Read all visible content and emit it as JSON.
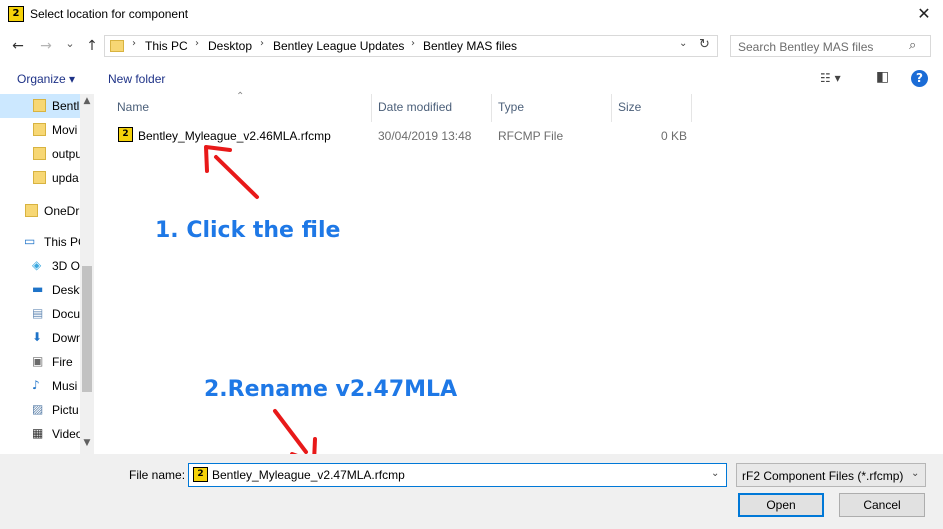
{
  "window": {
    "title": "Select location for component",
    "app_icon_label": "2",
    "close_glyph": "✕"
  },
  "address_bar": {
    "back_glyph": "←",
    "forward_glyph": "→",
    "recent_glyph": "⌄",
    "up_glyph": "↑",
    "breadcrumb": [
      "This PC",
      "Desktop",
      "Bentley League Updates",
      "Bentley MAS files"
    ],
    "crumb_separator": "›",
    "dropdown_glyph": "⌄",
    "refresh_glyph": "↻"
  },
  "search": {
    "placeholder": "Search Bentley MAS files",
    "icon_glyph": "⌕"
  },
  "toolbar": {
    "organize_label": "Organize ▾",
    "new_folder_label": "New folder",
    "view_glyph": "☷ ▾",
    "pane_glyph": "◧",
    "help_glyph": "?"
  },
  "nav_pane": {
    "items": [
      {
        "label": "Bentl",
        "icon": "folder-icon"
      },
      {
        "label": "Movi",
        "icon": "folder-icon"
      },
      {
        "label": "outpu",
        "icon": "folder-icon"
      },
      {
        "label": "upda",
        "icon": "folder-icon"
      },
      {
        "label": "OneDr",
        "icon": "folder-icon"
      },
      {
        "label": "This PC",
        "icon": "computer-icon"
      },
      {
        "label": "3D O",
        "icon": "cube-icon"
      },
      {
        "label": "Deskt",
        "icon": "desktop-icon"
      },
      {
        "label": "Docu",
        "icon": "document-icon"
      },
      {
        "label": "Down",
        "icon": "download-icon"
      },
      {
        "label": "Fire",
        "icon": "drive-icon"
      },
      {
        "label": "Musi",
        "icon": "music-icon"
      },
      {
        "label": "Pictu",
        "icon": "picture-icon"
      },
      {
        "label": "Video",
        "icon": "video-icon"
      }
    ],
    "scroll_up": "▲",
    "scroll_down": "▼"
  },
  "file_list": {
    "columns": [
      "Name",
      "Date modified",
      "Type",
      "Size"
    ],
    "sort_glyph": "⌃",
    "rows": [
      {
        "name": "Bentley_Myleague_v2.46MLA.rfcmp",
        "date": "30/04/2019 13:48",
        "type": "RFCMP File",
        "size": "0 KB"
      }
    ]
  },
  "annotations": {
    "step1": "1. Click the file",
    "step2": "2.Rename v2.47MLA",
    "color": "#1e78e6",
    "arrow_color": "#e81919"
  },
  "footer": {
    "file_name_label": "File name:",
    "file_name_value": "Bentley_Myleague_v2.47MLA.rfcmp",
    "dropdown_glyph": "⌄",
    "filter_value": "rF2 Component Files (*.rfcmp)",
    "open_label": "Open",
    "cancel_label": "Cancel"
  }
}
